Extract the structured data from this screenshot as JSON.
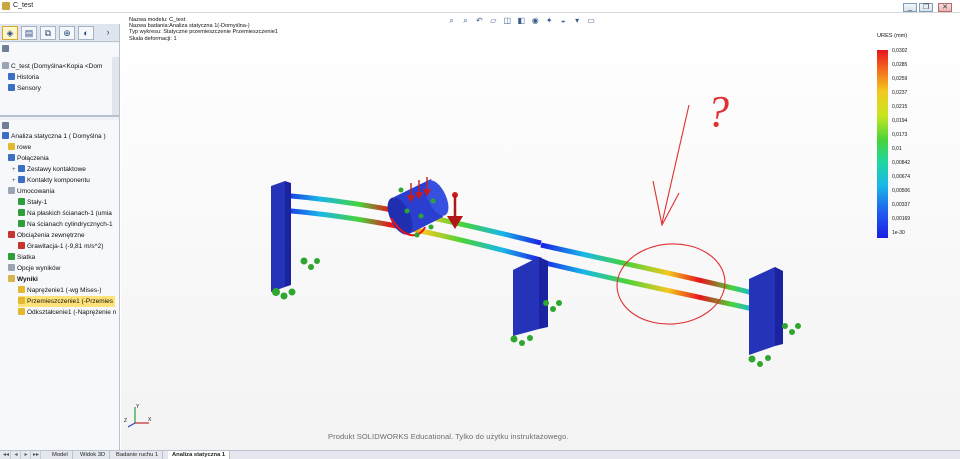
{
  "window": {
    "title": "C_test",
    "minimize_glyph": "_",
    "restore_glyph": "❐",
    "close_glyph": "✕"
  },
  "manager_tabs": [
    {
      "icon": "feature-manager-icon"
    },
    {
      "icon": "property-manager-icon"
    },
    {
      "icon": "configuration-manager-icon"
    },
    {
      "icon": "dimxpert-icon"
    },
    {
      "icon": "display-manager-icon"
    }
  ],
  "top_tree": {
    "model_row": "C_test  (Domyślna<Kopia <Dom",
    "history": "Historia",
    "sensors": "Sensory"
  },
  "study_tree": {
    "study": "Analiza statyczna 1 ( Domyślna )",
    "part": "rowe",
    "connections": "Połączenia",
    "contact_sets": "Zestawy kontaktowe",
    "component_contacts": "Kontakty komponentu",
    "fixtures": "Umocowania",
    "fixed1": "Stały-1",
    "flat_faces": "Na płaskich ścianach-1 (umia",
    "cyl_faces": "Na ścianach cylindrycznych-1",
    "external_loads": "Obciążenia zewnętrzne",
    "gravity": "Grawitacja-1 (-9,81 m/s^2)",
    "mesh": "Siatka",
    "result_options": "Opcje wyników",
    "results": "Wyniki",
    "stress1": "Naprężenie1 (-wg Mises-)",
    "displacement1": "Przemieszczenie1 (-Przemies",
    "strain1": "Odkształcenie1 (-Naprężenie n"
  },
  "study_info": {
    "line1": "Nazwa modelu: C_test",
    "line2": "Nazwa badania:Analiza statyczna 1(-Domyślna-)",
    "line3": "Typ wykresu: Statyczne przemieszczenie Przemieszczenie1",
    "line4": "Skala deformacji: 1"
  },
  "hud_icons": [
    "zoom-to-fit-icon",
    "zoom-area-icon",
    "previous-view-icon",
    "section-view-icon",
    "view-orientation-icon",
    "display-style-icon",
    "hide-show-icon",
    "edit-appearance-icon",
    "apply-scene-icon",
    "view-settings-icon",
    "monitor-icon"
  ],
  "legend": {
    "title": "URES (mm)",
    "ticks": [
      "0,0302",
      "0,0285",
      "0,0259",
      "0,0237",
      "0,0215",
      "0,0194",
      "0,0173",
      "0,01",
      "0,00842",
      "0,00674",
      "0,00506",
      "0,00337",
      "0,00169",
      "1e-30"
    ]
  },
  "watermark": "Produkt SOLIDWORKS Educational. Tylko do użytku instruktażowego.",
  "triad": {
    "x": "X",
    "y": "Y",
    "z": "Z"
  },
  "annotation": {
    "question_mark": "?"
  },
  "bottom_tabs": {
    "nav_first": "◂◂",
    "nav_prev": "◂",
    "nav_next": "▸",
    "nav_last": "▸▸",
    "tabs": [
      "Model",
      "Widok 3D",
      "Badanie ruchu 1",
      "Analiza statyczna 1"
    ]
  }
}
